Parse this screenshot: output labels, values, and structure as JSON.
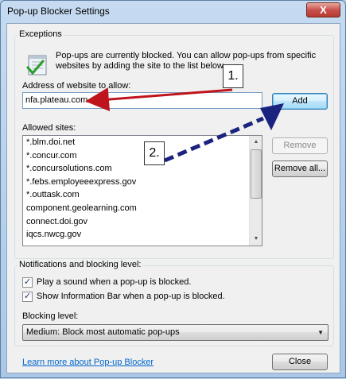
{
  "window": {
    "title": "Pop-up Blocker Settings",
    "close_glyph": "X"
  },
  "exceptions": {
    "group_label": "Exceptions",
    "description_line1": "Pop-ups are currently blocked.  You can allow pop-ups from specific",
    "description_line2": "websites by adding the site to the list below.",
    "address_label": "Address of website to allow:",
    "address_value": "nfa.plateau.com",
    "add_button": "Add",
    "allowed_label": "Allowed sites:",
    "allowed_sites": [
      "*.blm.doi.net",
      "*.concur.com",
      "*.concursolutions.com",
      "*.febs.employeeexpress.gov",
      "*.outtask.com",
      "component.geolearning.com",
      "connect.doi.gov",
      "iqcs.nwcg.gov"
    ],
    "remove_button": "Remove",
    "remove_all_button": "Remove all..."
  },
  "notifications": {
    "group_label": "Notifications and blocking level:",
    "play_sound_label": "Play a sound when a pop-up is blocked.",
    "play_sound_checked": true,
    "info_bar_label": "Show Information Bar when a pop-up is blocked.",
    "info_bar_checked": true,
    "check_glyph": "✓",
    "blocking_level_label": "Blocking level:",
    "blocking_level_value": "Medium: Block most automatic pop-ups",
    "dropdown_glyph": "▼"
  },
  "footer": {
    "learn_more_link": "Learn more about Pop-up Blocker",
    "close_button": "Close"
  },
  "annotations": {
    "callout_1": "1.",
    "callout_2": "2."
  },
  "scrollbar": {
    "up_glyph": "▲",
    "down_glyph": "▼"
  },
  "colors": {
    "red_arrow": "#c0141c",
    "blue_arrow": "#1a237e",
    "link": "#0066cc"
  },
  "icons": {
    "exceptions": "shield-check-icon"
  }
}
